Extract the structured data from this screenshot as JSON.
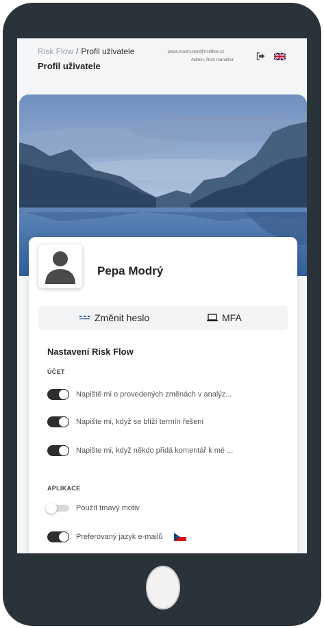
{
  "header": {
    "breadcrumb_root": "Risk Flow",
    "breadcrumb_separator": "/",
    "breadcrumb_current": "Profil uživatele",
    "page_title": "Profil uživatele",
    "user_email": "pepa.modry.test@riskflow.cz",
    "user_role": "Admin, Risk manažer",
    "logout_icon": "logout-icon",
    "language_flag": "uk-flag-icon"
  },
  "profile": {
    "name": "Pepa Modrý",
    "avatar_icon": "user-avatar-icon"
  },
  "actions": {
    "change_password": "Změnit heslo",
    "change_password_icon": "password-dots-icon",
    "mfa": "MFA",
    "mfa_icon": "laptop-icon"
  },
  "settings": {
    "title": "Nastavení Risk Flow",
    "account_label": "ÚČET",
    "account_items": [
      {
        "label": "Napiště mi o provedených změnách v analýz...",
        "enabled": true
      },
      {
        "label": "Napište mi, když se blíží termín řešení",
        "enabled": true
      },
      {
        "label": "Napište mi, když někdo přidá komentář k mé ...",
        "enabled": true
      }
    ],
    "app_label": "APLIKACE",
    "app_items": [
      {
        "label": "Použít tmavý motiv",
        "enabled": false
      },
      {
        "label": "Preferovaný jazyk e-mailů",
        "enabled": true,
        "flag": "cz-flag-icon"
      }
    ]
  },
  "colors": {
    "phone_frame": "#2b333a",
    "screen_bg": "#f4f5f7",
    "toggle_on": "#2e2e2e",
    "toggle_off": "#d9d9d9"
  }
}
